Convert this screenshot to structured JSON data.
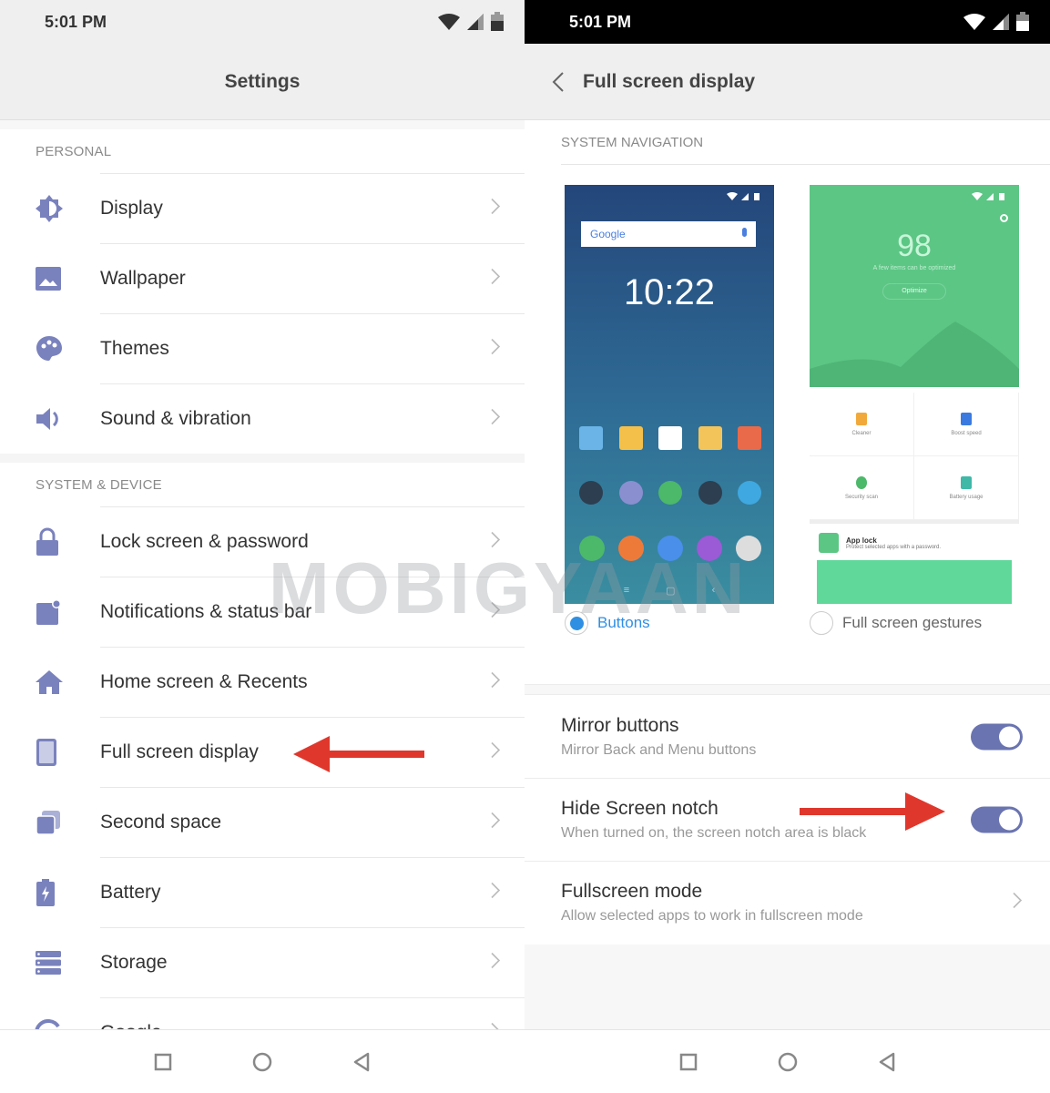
{
  "left": {
    "status": {
      "time": "5:01 PM"
    },
    "title": "Settings",
    "sections": [
      {
        "header": "PERSONAL",
        "items": [
          {
            "label": "Display",
            "icon": "brightness-icon"
          },
          {
            "label": "Wallpaper",
            "icon": "image-icon"
          },
          {
            "label": "Themes",
            "icon": "palette-icon"
          },
          {
            "label": "Sound & vibration",
            "icon": "speaker-icon"
          }
        ]
      },
      {
        "header": "SYSTEM & DEVICE",
        "items": [
          {
            "label": "Lock screen & password",
            "icon": "lock-icon"
          },
          {
            "label": "Notifications & status bar",
            "icon": "notification-icon"
          },
          {
            "label": "Home screen & Recents",
            "icon": "home-icon"
          },
          {
            "label": "Full screen display",
            "icon": "phone-icon"
          },
          {
            "label": "Second space",
            "icon": "layers-icon"
          },
          {
            "label": "Battery",
            "icon": "battery-icon"
          },
          {
            "label": "Storage",
            "icon": "storage-icon"
          },
          {
            "label": "Google",
            "icon": "google-icon"
          }
        ]
      }
    ]
  },
  "right": {
    "status": {
      "time": "5:01 PM"
    },
    "title": "Full screen display",
    "section_header": "SYSTEM NAVIGATION",
    "preview_buttons": {
      "search_brand": "Google",
      "clock": "10:22",
      "label": "Buttons",
      "selected": true
    },
    "preview_gestures": {
      "score": "98",
      "score_sub": "A few items can be optimized",
      "optimize": "Optimize",
      "tiles": [
        "Cleaner",
        "Boost speed",
        "Security scan",
        "Battery usage"
      ],
      "applock_title": "App lock",
      "applock_sub": "Protect selected apps with a password.",
      "label": "Full screen gestures",
      "selected": false
    },
    "settings": [
      {
        "title": "Mirror buttons",
        "subtitle": "Mirror Back and Menu buttons",
        "type": "toggle",
        "on": true
      },
      {
        "title": "Hide Screen notch",
        "subtitle": "When turned on, the screen notch area is black",
        "type": "toggle",
        "on": true
      },
      {
        "title": "Fullscreen mode",
        "subtitle": "Allow selected apps to work in fullscreen mode",
        "type": "link"
      }
    ]
  },
  "watermark": "MOBIGYAAN",
  "colors": {
    "icon": "#7a82bd",
    "toggle": "#6a74b0",
    "radio": "#2f8fe3",
    "arrow": "#e0372c"
  }
}
